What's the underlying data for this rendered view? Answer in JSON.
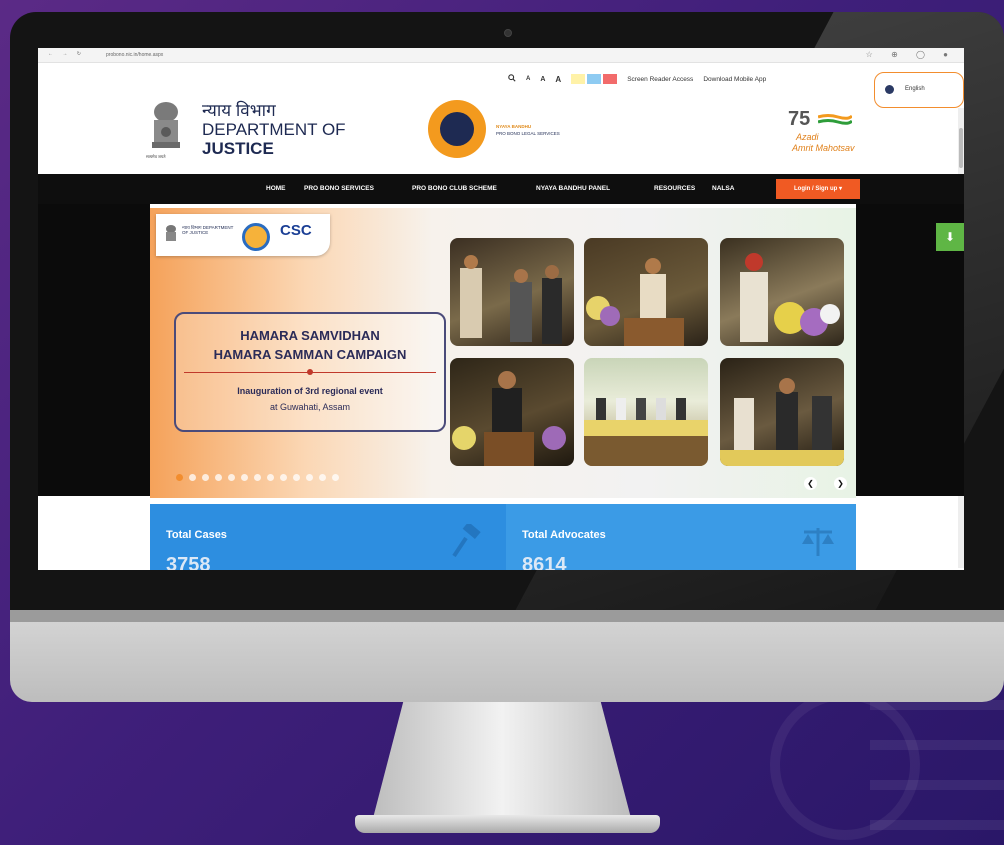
{
  "browser": {
    "url": "probono.nic.in/home.aspx",
    "nav_glyphs": "← → ↻",
    "right_glyphs": "☆ ⊕ ◯ ●"
  },
  "accessibility": {
    "zoom_out": "A",
    "zoom_normal": "A",
    "zoom_in": "A",
    "screen_reader": "Screen Reader Access",
    "download_app": "Download Mobile App",
    "theme_colors": [
      "#fff2a8",
      "#8ecbf2",
      "#f26b6b"
    ]
  },
  "language": {
    "selected": "English"
  },
  "header": {
    "dept_hindi": "न्याय विभाग",
    "dept_line1": "DEPARTMENT OF",
    "dept_line2": "JUSTICE",
    "emblem_caption": "सत्यमेव जयते",
    "probono_line1": "NYAYA BANDHU",
    "probono_line2": "PRO BONO LEGAL SERVICES",
    "aka_number": "75",
    "aka_line1": "Azadi",
    "aka_line2": "Amrit Mahotsav"
  },
  "nav": {
    "items": [
      {
        "label": "HOME"
      },
      {
        "label": "PRO BONO SERVICES"
      },
      {
        "label": "PRO BONO CLUB SCHEME"
      },
      {
        "label": "NYAYA BANDHU PANEL"
      },
      {
        "label": "RESOURCES"
      },
      {
        "label": "NALSA"
      }
    ],
    "login_label": "Login / Sign up ▾"
  },
  "hero": {
    "logo_doj": "न्याय विभाग DEPARTMENT OF JUSTICE",
    "logo_csc": "CSC",
    "title_line1": "HAMARA SAMVIDHAN",
    "title_line2": "HAMARA SAMMAN CAMPAIGN",
    "subtitle_line1": "Inauguration of 3rd regional event",
    "subtitle_line2": "at Guwahati, Assam",
    "slide_count": 13,
    "active_slide": 1,
    "prev_glyph": "❮",
    "next_glyph": "❯"
  },
  "stats": [
    {
      "label": "Total Cases",
      "value": "3758",
      "icon": "gavel-icon"
    },
    {
      "label": "Total Advocates",
      "value": "8614",
      "icon": "scales-icon"
    }
  ]
}
